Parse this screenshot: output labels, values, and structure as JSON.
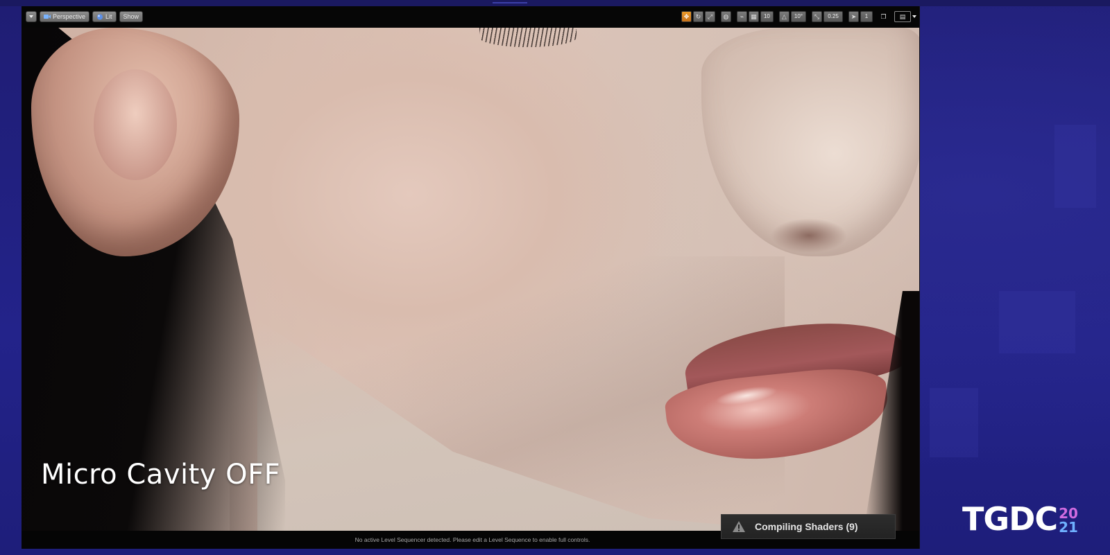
{
  "toolbar": {
    "menu_caret_icon": "chevron-down-icon",
    "perspective_label": "Perspective",
    "lit_label": "Lit",
    "show_label": "Show",
    "grid_snap_value": "10",
    "rotation_snap_value": "10°",
    "scale_snap_value": "0.25",
    "camera_speed_value": "1",
    "active_color": "#e08a22"
  },
  "viewport": {
    "caption": "Micro Cavity OFF"
  },
  "status_bar": {
    "message": "No active Level Sequencer detected. Please edit a Level Sequence to enable full controls."
  },
  "notification": {
    "icon": "warning-icon",
    "text": "Compiling Shaders (9)"
  },
  "branding": {
    "logo_text": "TGDC",
    "year_top": "20",
    "year_bottom": "21",
    "background_color": "#1f1d73"
  }
}
